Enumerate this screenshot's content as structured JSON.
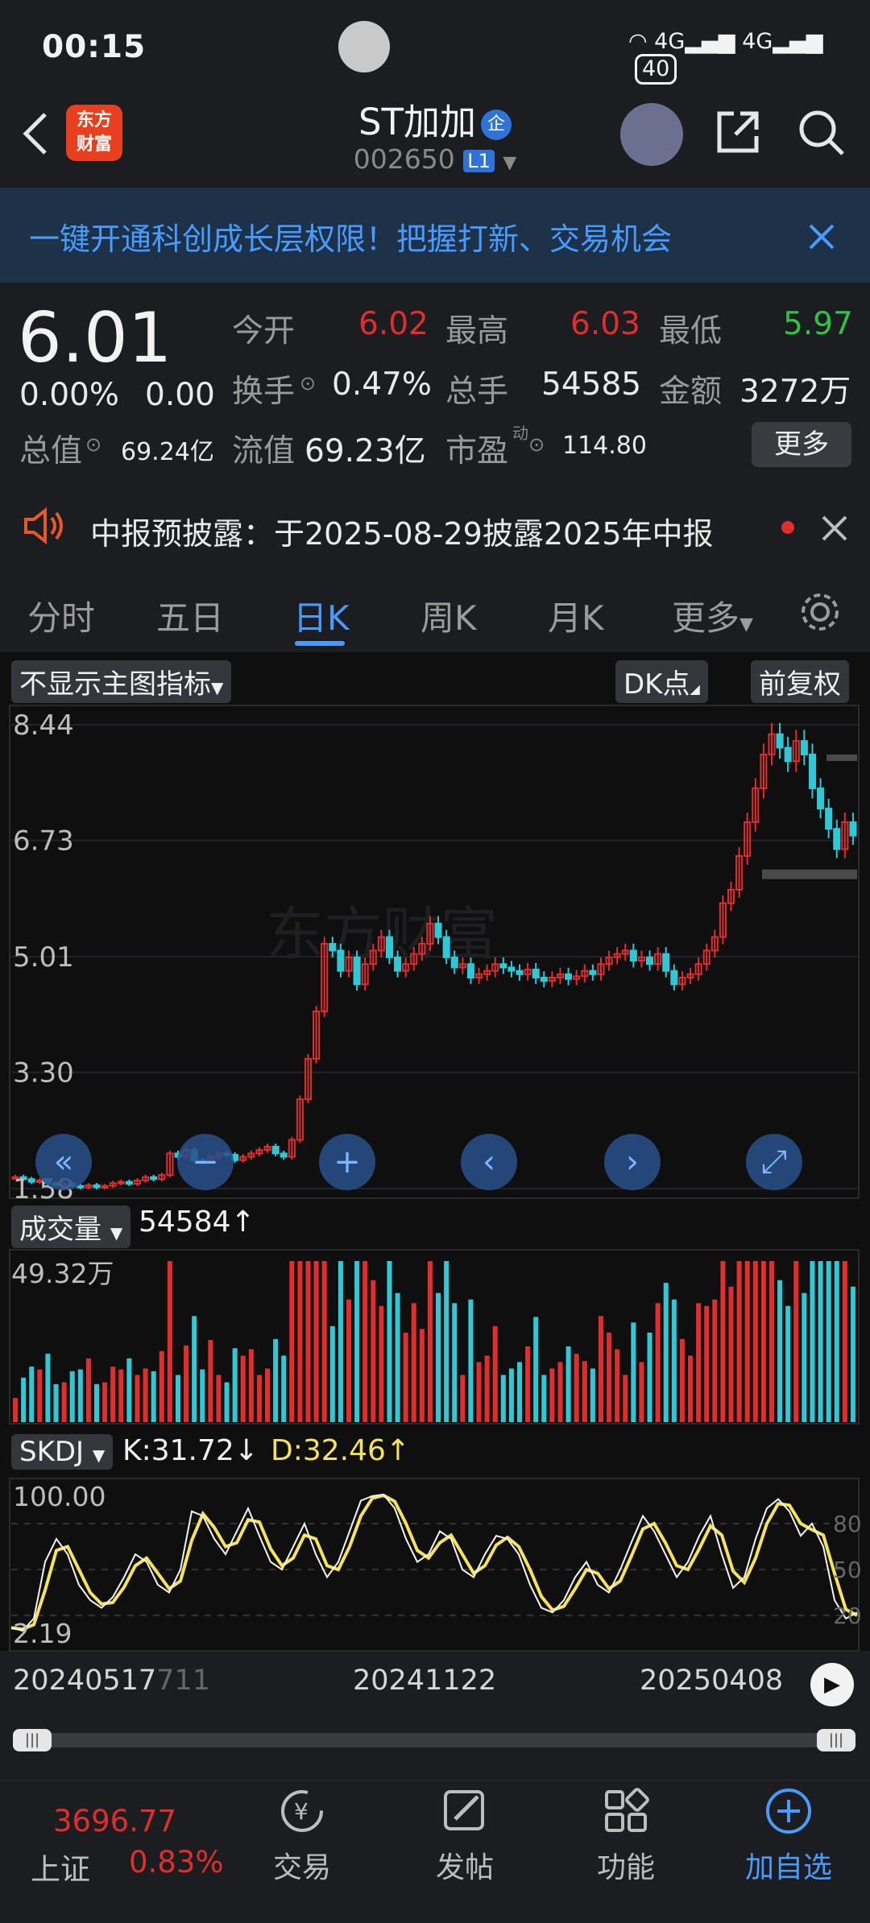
{
  "status": {
    "time": "00:15",
    "net1": "4G",
    "net2": "4G",
    "battery": "40"
  },
  "header": {
    "logo_line1": "东方",
    "logo_line2": "财富",
    "name": "ST加加",
    "badge": "企",
    "code": "002650",
    "level": "L1"
  },
  "promo": {
    "text": "一键开通科创成长层权限！把握打新、交易机会"
  },
  "quote": {
    "price": "6.01",
    "change_pct": "0.00%",
    "change": "0.00",
    "open_label": "今开",
    "open": "6.02",
    "high_label": "最高",
    "high": "6.03",
    "low_label": "最低",
    "low": "5.97",
    "turnover_label": "换手",
    "turnover": "0.47%",
    "volume_label": "总手",
    "volume": "54585",
    "amount_label": "金额",
    "amount": "3272万",
    "mktcap_label": "总值",
    "mktcap": "69.24亿",
    "float_label": "流值",
    "float": "69.23亿",
    "pe_label": "市盈",
    "pe_sup": "动",
    "pe": "114.80",
    "more": "更多"
  },
  "notice": {
    "text": "中报预披露：于2025-08-29披露2025年中报"
  },
  "tabs": [
    {
      "label": "分时"
    },
    {
      "label": "五日"
    },
    {
      "label": "日K"
    },
    {
      "label": "周K"
    },
    {
      "label": "月K"
    },
    {
      "label": "更多"
    }
  ],
  "chart_toolbar": {
    "indicator": "不显示主图指标",
    "dk": "DK点",
    "fq": "前复权"
  },
  "watermark": "东方财富",
  "chart_data": [
    {
      "type": "candlestick",
      "y_ticks": [
        "8.44",
        "6.73",
        "5.01",
        "3.30",
        "1.58"
      ],
      "ylim": [
        1.58,
        8.44
      ],
      "x_ticks": [
        "20240517",
        "20241122",
        "20250408"
      ],
      "x_tick_overlap": "711",
      "closes": [
        1.75,
        1.72,
        1.68,
        1.7,
        1.66,
        1.63,
        1.65,
        1.62,
        1.6,
        1.63,
        1.6,
        1.62,
        1.66,
        1.68,
        1.65,
        1.7,
        1.75,
        1.72,
        1.78,
        2.1,
        2.05,
        2.15,
        2.0,
        1.98,
        2.05,
        2.1,
        2.08,
        2.0,
        2.05,
        2.1,
        2.15,
        2.2,
        2.1,
        2.05,
        2.3,
        2.9,
        3.5,
        4.2,
        5.2,
        5.1,
        4.8,
        5.0,
        4.6,
        4.9,
        5.1,
        5.3,
        5.0,
        4.8,
        4.9,
        5.05,
        5.2,
        5.5,
        5.3,
        5.0,
        4.85,
        4.9,
        4.7,
        4.75,
        4.8,
        4.9,
        4.85,
        4.8,
        4.75,
        4.82,
        4.7,
        4.65,
        4.7,
        4.75,
        4.68,
        4.72,
        4.8,
        4.75,
        4.9,
        5.0,
        5.05,
        5.1,
        4.95,
        5.0,
        4.9,
        5.05,
        4.8,
        4.6,
        4.7,
        4.75,
        4.9,
        5.1,
        5.3,
        5.8,
        6.0,
        6.5,
        7.0,
        7.5,
        8.0,
        8.3,
        8.1,
        7.9,
        8.2,
        8.0,
        7.5,
        7.2,
        6.9,
        6.6,
        7.0,
        6.8
      ]
    },
    {
      "type": "bar",
      "name": "成交量",
      "current": "54584",
      "y_top_label": "49.32万",
      "ylim": [
        0,
        49.32
      ]
    },
    {
      "type": "line",
      "name": "SKDJ",
      "k_label": "K:31.72",
      "d_label": "D:32.46",
      "y_left_ticks": [
        "100.00",
        "2.19"
      ],
      "y_right_ticks": [
        "80",
        "50",
        "20"
      ],
      "ylim": [
        2.19,
        100
      ],
      "k": [
        12,
        10,
        18,
        55,
        70,
        60,
        40,
        30,
        25,
        32,
        45,
        60,
        55,
        40,
        35,
        50,
        88,
        85,
        70,
        60,
        75,
        90,
        72,
        55,
        50,
        65,
        80,
        60,
        45,
        55,
        75,
        95,
        98,
        99,
        90,
        70,
        55,
        60,
        75,
        70,
        50,
        45,
        60,
        72,
        70,
        60,
        40,
        25,
        22,
        30,
        45,
        55,
        40,
        35,
        50,
        68,
        85,
        75,
        60,
        45,
        55,
        72,
        85,
        60,
        38,
        45,
        70,
        90,
        96,
        88,
        72,
        80,
        65,
        30,
        18,
        22
      ]
    }
  ],
  "chart_buttons": [
    "rewind-button",
    "zoom-out-button",
    "zoom-in-button",
    "prev-button",
    "next-button",
    "fullscreen-button"
  ],
  "bottom": {
    "index_value": "3696.77",
    "index_name": "上证",
    "index_change": "0.83%",
    "trade": "交易",
    "post": "发帖",
    "func": "功能",
    "watch": "加自选"
  },
  "colors": {
    "up": "#e02d2d",
    "down": "#2fc8d4",
    "accent": "#4a9bff",
    "k_line": "#f2f2f2",
    "d_line": "#f6e35a"
  }
}
